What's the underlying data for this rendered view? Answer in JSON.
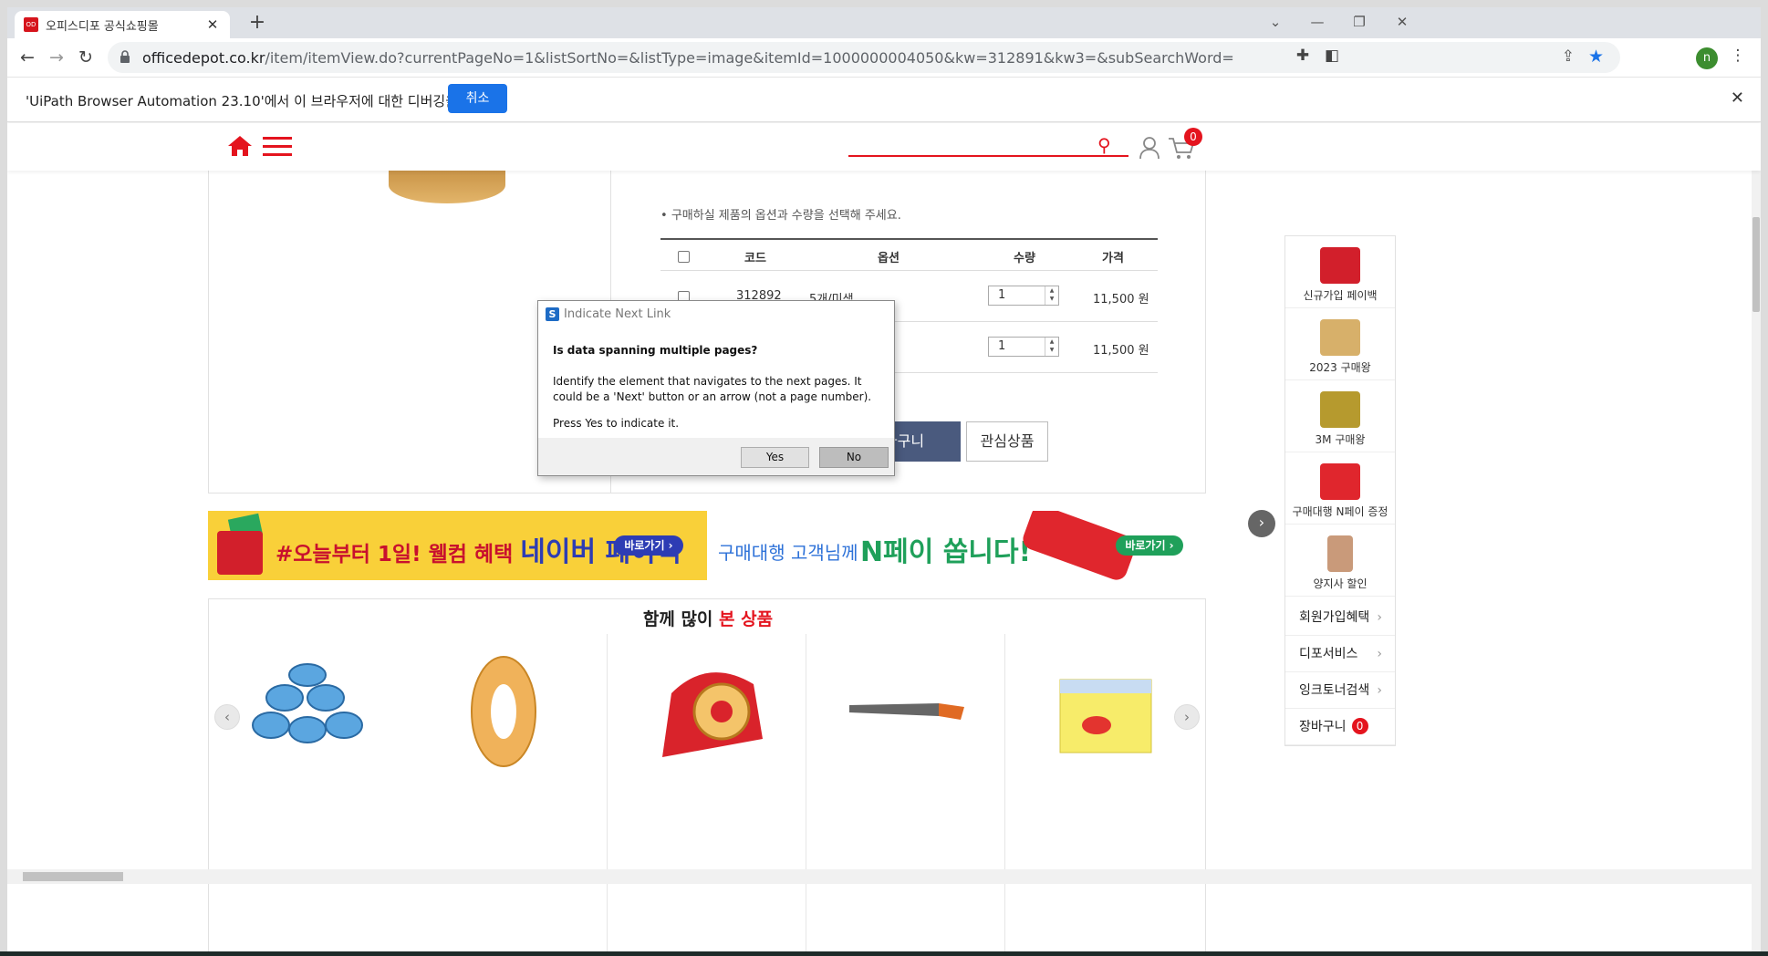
{
  "browser": {
    "tab_title": "오피스디포 공식쇼핑몰",
    "url_host": "officedepot.co.kr",
    "url_rest": "/item/itemView.do?currentPageNo=1&listSortNo=&listType=image&itemId=1000000004050&kw=312891&kw3=&subSearchWord=",
    "profile_initial": "n",
    "accent": "#1a73e8"
  },
  "infobar": {
    "message": "'UiPath Browser Automation 23.10'에서 이 브라우저에 대한 디버깅을 시작함",
    "cancel_label": "취소"
  },
  "site": {
    "brand_color": "#e4141e",
    "cart_count": "0"
  },
  "product": {
    "notice": "구매하실 제품의 옵션과 수량을 선택해 주세요.",
    "table_headers": {
      "code": "코드",
      "option": "옵션",
      "qty": "수량",
      "price": "가격"
    },
    "rows": [
      {
        "code": "312892",
        "option": "5개/미색",
        "qty": "1",
        "price": "11,500 원"
      },
      {
        "code": "",
        "option": "",
        "qty": "1",
        "price": "11,500 원"
      }
    ],
    "cart_button": "바구니",
    "wish_button": "관심상품"
  },
  "banners": {
    "left_text": "#오늘부터 1일! 웰컴 혜택",
    "left_highlight": "네이버 페이백",
    "left_go": "바로가기 ›",
    "right_text": "구매대행 고객님께",
    "right_highlight": "N페이 쏩니다!",
    "right_go": "바로가기 ›"
  },
  "related": {
    "title_part1": "함께 많이",
    "title_part2": "본 상품"
  },
  "quickmenu": {
    "items": [
      {
        "label": "신규가입 페이백"
      },
      {
        "label": "2023 구매왕"
      },
      {
        "label": "3M 구매왕"
      },
      {
        "label": "구매대행 N페이 증정"
      },
      {
        "label": "양지사 할인"
      }
    ],
    "links": [
      {
        "label": "회원가입혜택"
      },
      {
        "label": "디포서비스"
      },
      {
        "label": "잉크토너검색"
      },
      {
        "label": "장바구니",
        "badge": "0"
      }
    ]
  },
  "dialog": {
    "title": "Indicate Next Link",
    "question": "Is data spanning multiple pages?",
    "description": "Identify the element that navigates to the next pages. It could be a 'Next' button or an arrow (not a page number).",
    "prompt": "Press Yes to indicate it.",
    "yes_label": "Yes",
    "no_label": "No"
  }
}
